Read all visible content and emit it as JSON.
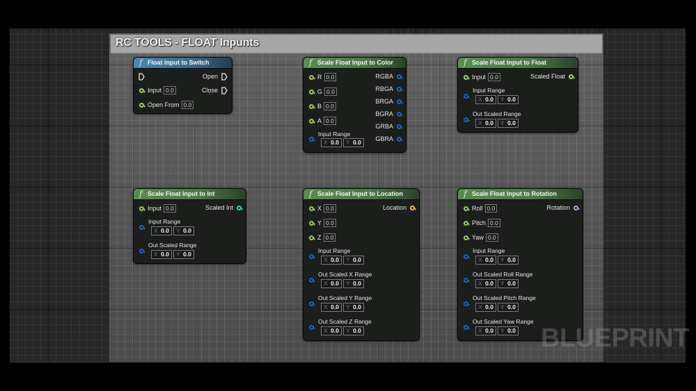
{
  "comment": {
    "title": "RC TOOLS - FLOAT Inpunts"
  },
  "watermark": "BLUEPRINT",
  "colors": {
    "float_pin": "#9cd442",
    "struct_pin": "#1c64c8",
    "int_pin": "#2ed6a0",
    "vector_pin": "#f0c020",
    "rotator_pin": "#9aaaf0",
    "pure_header": "#4e86ad",
    "function_header": "#5a8c50"
  },
  "nodes": {
    "switch": {
      "title": "Float Input to Switch",
      "icon": "function-icon",
      "outputs": [
        "Open",
        "Close"
      ],
      "inputs": [
        {
          "label": "Input",
          "value": "0.0"
        },
        {
          "label": "Open From",
          "value": "0.0"
        }
      ]
    },
    "color": {
      "title": "Scale Float Input to Color",
      "icon": "function-icon",
      "inputs": [
        {
          "label": "R",
          "value": "0.0"
        },
        {
          "label": "G",
          "value": "0.0"
        },
        {
          "label": "B",
          "value": "0.0"
        },
        {
          "label": "A",
          "value": "0.0"
        }
      ],
      "range": {
        "label": "Input Range",
        "x": "0.0",
        "y": "0.0"
      },
      "outputs": [
        "RGBA",
        "RBGA",
        "BRGA",
        "BGRA",
        "GRBA",
        "GBRA"
      ]
    },
    "float": {
      "title": "Scale Float Input to Float",
      "icon": "function-icon",
      "input": {
        "label": "Input",
        "value": "0.0"
      },
      "output": "Scaled Float",
      "ranges": [
        {
          "label": "Input Range",
          "x": "0.0",
          "y": "0.0"
        },
        {
          "label": "Out Scaled Range",
          "x": "0.0",
          "y": "0.0"
        }
      ]
    },
    "int": {
      "title": "Scale Float Input to Int",
      "icon": "function-icon",
      "input": {
        "label": "Input",
        "value": "0.0"
      },
      "output": "Scaled Int",
      "ranges": [
        {
          "label": "Input Range",
          "x": "0.0",
          "y": "0.0"
        },
        {
          "label": "Out Scaled Range",
          "x": "0.0",
          "y": "0.0"
        }
      ]
    },
    "location": {
      "title": "Scale Float Input to Location",
      "icon": "function-icon",
      "inputs": [
        {
          "label": "X",
          "value": "0.0"
        },
        {
          "label": "Y",
          "value": "0.0"
        },
        {
          "label": "Z",
          "value": "0.0"
        }
      ],
      "output": "Location",
      "ranges": [
        {
          "label": "Input Range",
          "x": "0.0",
          "y": "0.0"
        },
        {
          "label": "Out Scaled X Range",
          "x": "0.0",
          "y": "0.0"
        },
        {
          "label": "Out Scaled Y Range",
          "x": "0.0",
          "y": "0.0"
        },
        {
          "label": "Out Scaled Z Range",
          "x": "0.0",
          "y": "0.0"
        }
      ]
    },
    "rotation": {
      "title": "Scale Float Input to Rotation",
      "icon": "function-icon",
      "inputs": [
        {
          "label": "Roll",
          "value": "0.0"
        },
        {
          "label": "Pitch",
          "value": "0.0"
        },
        {
          "label": "Yaw",
          "value": "0.0"
        }
      ],
      "output": "Rotation",
      "ranges": [
        {
          "label": "Input Range",
          "x": "0.0",
          "y": "0.0"
        },
        {
          "label": "Out Scaled Roll Range",
          "x": "0.0",
          "y": "0.0"
        },
        {
          "label": "Out Scaled Pitch Range",
          "x": "0.0",
          "y": "0.0"
        },
        {
          "label": "Out Scaled Yaw Range",
          "x": "0.0",
          "y": "0.0"
        }
      ]
    }
  },
  "axis_labels": {
    "x": "X",
    "y": "Y"
  }
}
